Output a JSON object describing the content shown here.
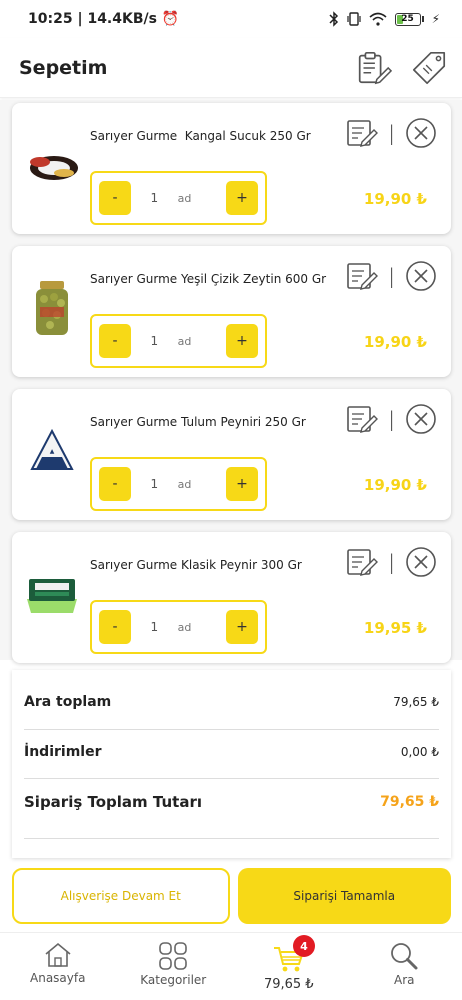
{
  "status_bar": {
    "time": "10:25",
    "speed": "14.4KB/s",
    "battery": "25",
    "battery_level": 0.25
  },
  "header": {
    "title": "Sepetim",
    "icons": [
      "clipboard-edit-icon",
      "tag-icon"
    ]
  },
  "cart": {
    "items": [
      {
        "name": "Sarıyer Gurme  Kangal Sucuk 250 Gr",
        "qty": "1",
        "unit": "ad",
        "minus": "-",
        "plus": "+",
        "price": "19,90 ₺",
        "image": "sausage-icon"
      },
      {
        "name": "Sarıyer Gurme Yeşil Çizik Zeytin 600 Gr",
        "qty": "1",
        "unit": "ad",
        "minus": "-",
        "plus": "+",
        "price": "19,90 ₺",
        "image": "olive-jar-icon"
      },
      {
        "name": "Sarıyer Gurme Tulum Peyniri 250 Gr",
        "qty": "1",
        "unit": "ad",
        "minus": "-",
        "plus": "+",
        "price": "19,90 ₺",
        "image": "cheese-wedge-icon"
      },
      {
        "name": "Sarıyer Gurme Klasik Peynir 300 Gr",
        "qty": "1",
        "unit": "ad",
        "minus": "-",
        "plus": "+",
        "price": "19,95 ₺",
        "image": "cheese-box-icon"
      }
    ]
  },
  "summary": {
    "subtotal_label": "Ara toplam",
    "subtotal_value": "79,65 ₺",
    "discount_label": "İndirimler",
    "discount_value": "0,00 ₺",
    "total_label": "Sipariş Toplam Tutarı",
    "total_value": "79,65 ₺"
  },
  "actions": {
    "continue_label": "Alışverişe Devam Et",
    "complete_label": "Siparişi Tamamla"
  },
  "bottom_nav": {
    "home_label": "Anasayfa",
    "categories_label": "Kategoriler",
    "cart_label": "79,65 ₺",
    "cart_badge": "4",
    "search_label": "Ara"
  },
  "colors": {
    "accent": "#f7d917",
    "total": "#f5a31a",
    "badge": "#e21b23"
  }
}
